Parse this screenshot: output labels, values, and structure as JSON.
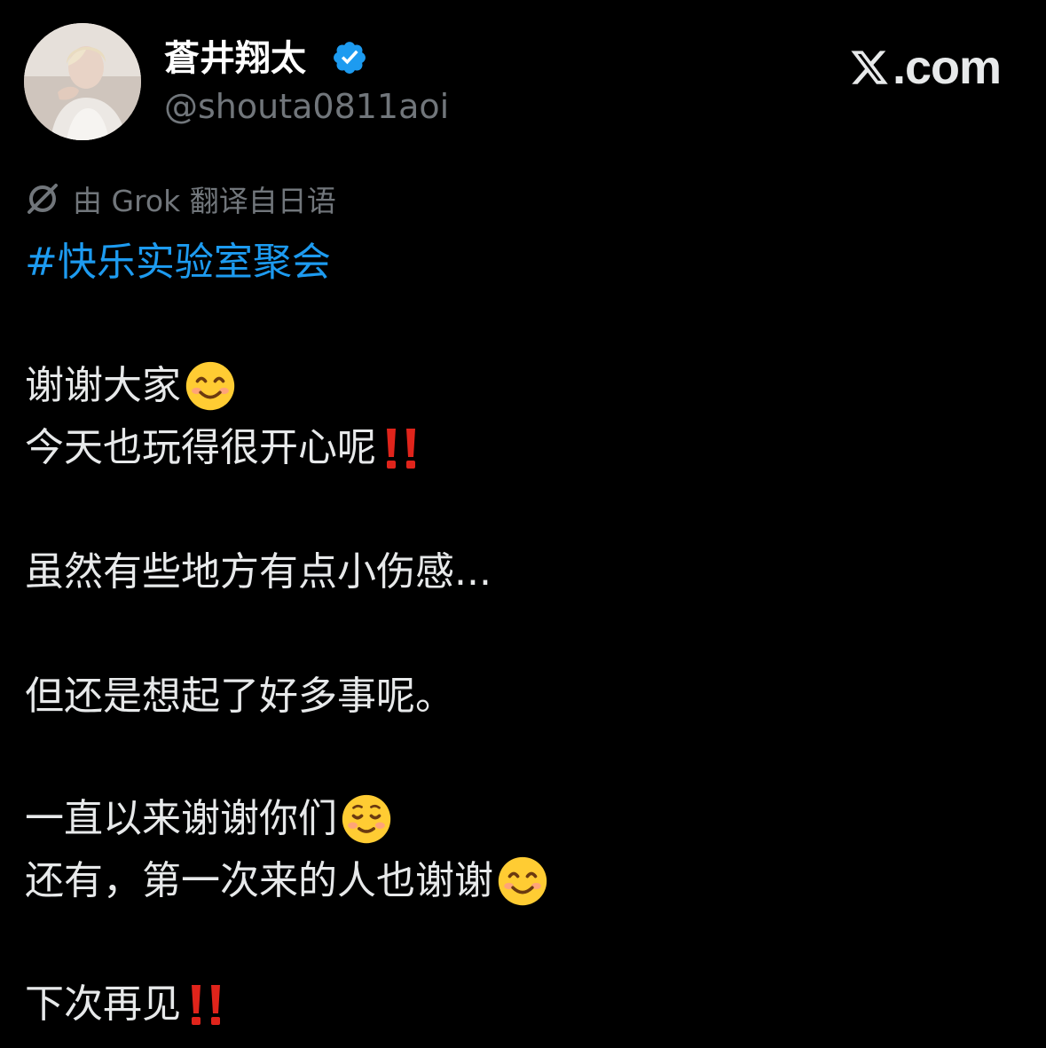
{
  "author": {
    "display_name": "蒼井翔太",
    "handle": "@shouta0811aoi",
    "verified": true,
    "avatar": "profile-photo"
  },
  "brand": {
    "text": ".com",
    "logo": "x-logo-icon"
  },
  "translation_note": "由 Grok 翻译自日语",
  "post": {
    "hashtag": "#快乐实验室聚会",
    "lines": [
      "谢谢大家",
      "今天也玩得很开心呢",
      "虽然有些地方有点小伤感...",
      "但还是想起了好多事呢。",
      "一直以来谢谢你们",
      "还有，第一次来的人也谢谢",
      "下次再见"
    ]
  },
  "colors": {
    "background": "#000000",
    "text": "#e7e9ea",
    "secondary": "#71767b",
    "link": "#1d9bf0",
    "verified": "#1d9bf0",
    "emphasis": "#e0241b"
  }
}
